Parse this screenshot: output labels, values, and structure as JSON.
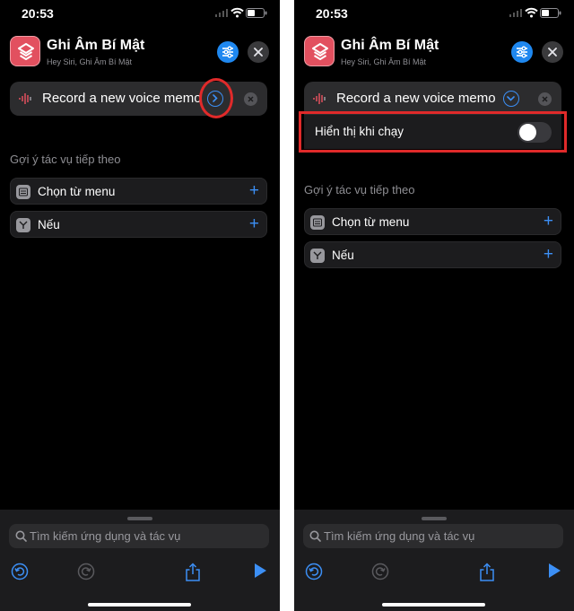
{
  "status_bar": {
    "time": "20:53"
  },
  "header": {
    "title": "Ghi Âm Bí Mật",
    "subtitle": "Hey Siri, Ghi Âm Bí Mật"
  },
  "action": {
    "label": "Record a new voice memo"
  },
  "toggle_row": {
    "label": "Hiển thị khi chạy",
    "value": false
  },
  "suggestions": {
    "heading": "Gợi ý tác vụ tiếp theo",
    "items": [
      {
        "label": "Chọn từ menu",
        "icon": "menu-icon"
      },
      {
        "label": "Nếu",
        "icon": "if-branch-icon"
      }
    ]
  },
  "search": {
    "placeholder": "Tìm kiếm ứng dụng và tác vụ"
  },
  "colors": {
    "accent": "#1f88f0",
    "app_icon": "#e2505f",
    "highlight": "#e02a2a",
    "background": "#000000"
  }
}
